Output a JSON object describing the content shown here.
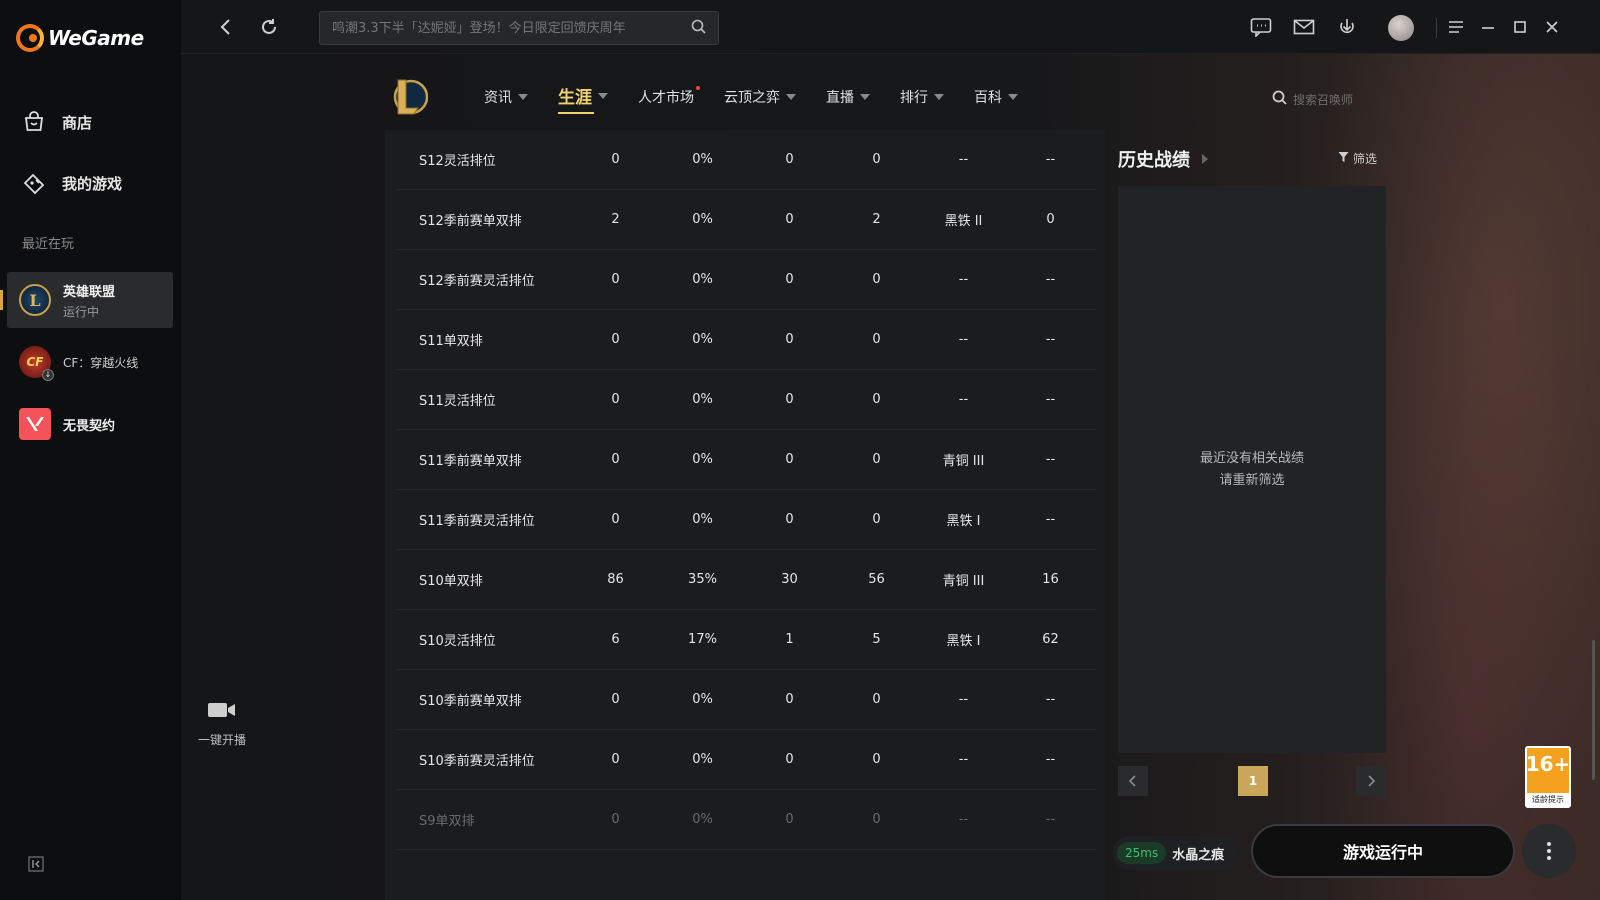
{
  "app": {
    "brand": "WeGame"
  },
  "sidebar": {
    "nav": [
      {
        "label": "商店",
        "icon": "shop-icon"
      },
      {
        "label": "我的游戏",
        "icon": "games-icon"
      }
    ],
    "recent_label": "最近在玩",
    "games": [
      {
        "name": "英雄联盟",
        "status": "运行中",
        "icon": "lol-icon",
        "active": true
      },
      {
        "name": "CF：穿越火线",
        "status": "",
        "icon": "cf-icon",
        "active": false
      },
      {
        "name": "无畏契约",
        "status": "",
        "icon": "valorant-icon",
        "active": false
      }
    ]
  },
  "topbar": {
    "search_placeholder": "鸣潮3.3下半「达妮娅」登场！今日限定回馈庆周年"
  },
  "lol_nav": {
    "tabs": [
      {
        "label": "资讯",
        "caret": true
      },
      {
        "label": "生涯",
        "caret": true,
        "active": true
      },
      {
        "label": "人才市场",
        "caret": false,
        "dot": true
      },
      {
        "label": "云顶之弈",
        "caret": true
      },
      {
        "label": "直播",
        "caret": true
      },
      {
        "label": "排行",
        "caret": true
      },
      {
        "label": "百科",
        "caret": true
      }
    ],
    "search_placeholder": "搜索召唤师"
  },
  "table": {
    "rows": [
      [
        "S12灵活排位",
        "0",
        "0%",
        "0",
        "0",
        "--",
        "--"
      ],
      [
        "S12季前赛单双排",
        "2",
        "0%",
        "0",
        "2",
        "黑铁 II",
        "0"
      ],
      [
        "S12季前赛灵活排位",
        "0",
        "0%",
        "0",
        "0",
        "--",
        "--"
      ],
      [
        "S11单双排",
        "0",
        "0%",
        "0",
        "0",
        "--",
        "--"
      ],
      [
        "S11灵活排位",
        "0",
        "0%",
        "0",
        "0",
        "--",
        "--"
      ],
      [
        "S11季前赛单双排",
        "0",
        "0%",
        "0",
        "0",
        "青铜 III",
        "--"
      ],
      [
        "S11季前赛灵活排位",
        "0",
        "0%",
        "0",
        "0",
        "黑铁 I",
        "--"
      ],
      [
        "S10单双排",
        "86",
        "35%",
        "30",
        "56",
        "青铜 III",
        "16"
      ],
      [
        "S10灵活排位",
        "6",
        "17%",
        "1",
        "5",
        "黑铁 I",
        "62"
      ],
      [
        "S10季前赛单双排",
        "0",
        "0%",
        "0",
        "0",
        "--",
        "--"
      ],
      [
        "S10季前赛灵活排位",
        "0",
        "0%",
        "0",
        "0",
        "--",
        "--"
      ],
      [
        "S9单双排",
        "0",
        "0%",
        "0",
        "0",
        "--",
        "--"
      ]
    ]
  },
  "history": {
    "title": "历史战绩",
    "filter_label": "筛选",
    "empty_line1": "最近没有相关战绩",
    "empty_line2": "请重新筛选",
    "current_page": "1"
  },
  "live": {
    "label": "一键开播"
  },
  "status": {
    "ping": "25ms",
    "server": "水晶之痕",
    "launch_label": "游戏运行中"
  },
  "age_badge": {
    "number": "16+",
    "text": "适龄提示"
  }
}
